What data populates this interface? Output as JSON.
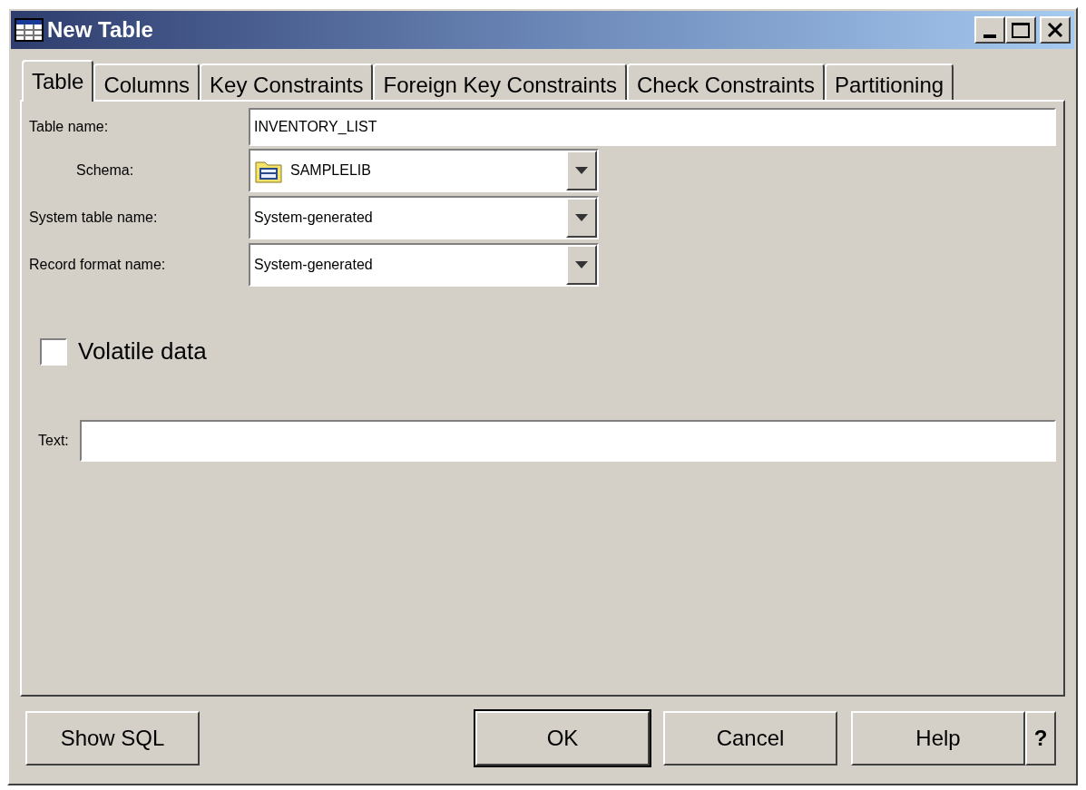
{
  "window": {
    "title": "New Table"
  },
  "tabs": [
    {
      "label": "Table",
      "selected": true
    },
    {
      "label": "Columns",
      "selected": false
    },
    {
      "label": "Key Constraints",
      "selected": false
    },
    {
      "label": "Foreign Key Constraints",
      "selected": false
    },
    {
      "label": "Check Constraints",
      "selected": false
    },
    {
      "label": "Partitioning",
      "selected": false
    }
  ],
  "fields": [
    {
      "kind": "text",
      "label": "Table name:",
      "value": "INVENTORY_LIST"
    },
    {
      "kind": "icon_combo",
      "label": "Schema:",
      "value": "SAMPLELIB"
    },
    {
      "kind": "combo",
      "label": "System table name:",
      "value": "System-generated"
    },
    {
      "kind": "combo",
      "label": "Record format name:",
      "value": "System-generated"
    }
  ],
  "checkbox": {
    "label": "Volatile data",
    "checked": false
  },
  "text_field": {
    "label": "Text:"
  },
  "buttons_left": [
    {
      "label": "Show SQL",
      "default": false
    }
  ],
  "buttons_right": [
    {
      "label": "OK",
      "default": true
    },
    {
      "label": "Cancel",
      "default": false
    },
    {
      "label": "Help",
      "default": false
    }
  ],
  "help_key": "?"
}
